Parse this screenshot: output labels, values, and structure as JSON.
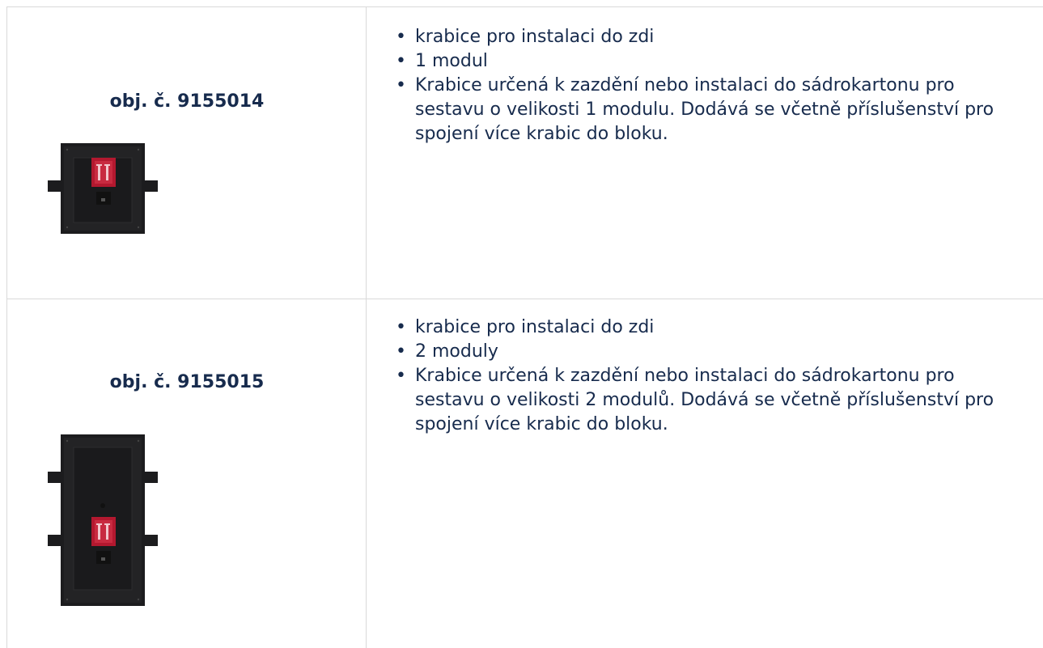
{
  "products": [
    {
      "order_no": "obj. č. 9155014",
      "image_icon": "wall-box-1-module-image",
      "features": [
        "krabice pro instalaci do zdi",
        "1 modul",
        "Krabice určená k zazdění nebo instalaci do sádrokartonu pro sestavu o velikosti 1 modulu. Dodává se včetně příslušenství pro spojení více krabic do bloku."
      ]
    },
    {
      "order_no": "obj. č. 9155015",
      "image_icon": "wall-box-2-modules-image",
      "features": [
        "krabice pro instalaci do zdi",
        "2 moduly",
        "Krabice určená k zazdění nebo instalaci do sádrokartonu pro sestavu o velikosti 2 modulů. Dodává se včetně příslušenství pro spojení více krabic do bloku."
      ]
    }
  ],
  "colors": {
    "text": "#172b4d",
    "border": "#d9d9d9",
    "box_body": "#1c1c1e",
    "label_red": "#b3182f"
  }
}
